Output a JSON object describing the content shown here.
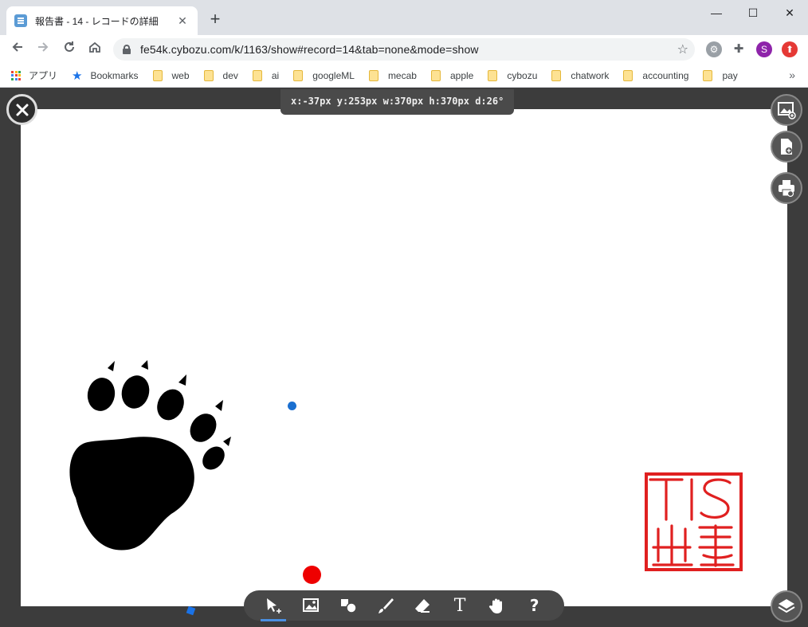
{
  "browser": {
    "tab_title": "報告書 - 14 - レコードの詳細",
    "tab_close_glyph": "✕",
    "new_tab_glyph": "+",
    "url": "fe54k.cybozu.com/k/1163/show#record=14&tab=none&mode=show",
    "window_controls": {
      "minimize": "—",
      "maximize": "☐",
      "close": "✕"
    },
    "profile_initial": "S",
    "bookmarks_apps_label": "アプリ",
    "bookmarks": [
      "Bookmarks",
      "web",
      "dev",
      "ai",
      "googleML",
      "mecab",
      "apple",
      "cybozu",
      "chatwork",
      "accounting",
      "pay"
    ],
    "bookmarks_more": "»"
  },
  "editor": {
    "coordinate_readout": "x:-37px  y:253px  w:370px  h:370px  d:26°",
    "tools": [
      {
        "name": "select-tool",
        "icon": "cursor-icon",
        "active": true
      },
      {
        "name": "image-tool",
        "icon": "image-icon",
        "active": false
      },
      {
        "name": "shape-tool",
        "icon": "shapes-icon",
        "active": false
      },
      {
        "name": "pen-tool",
        "icon": "brush-icon",
        "active": false
      },
      {
        "name": "eraser-tool",
        "icon": "eraser-icon",
        "active": false
      },
      {
        "name": "text-tool",
        "icon": "text-icon",
        "label": "T",
        "active": false
      },
      {
        "name": "hand-tool",
        "icon": "hand-icon",
        "active": false
      },
      {
        "name": "help-tool",
        "icon": "help-icon",
        "label": "?",
        "active": false
      }
    ],
    "side_buttons": [
      "add-image-icon",
      "add-file-icon",
      "print-icon"
    ],
    "layers_button": "layers-icon",
    "stamp_text": "TIS"
  },
  "colors": {
    "accent": "#4a90e2",
    "stamp_red": "#e02020",
    "dot_red": "#ee0000",
    "dot_blue": "#1a6fd0"
  }
}
